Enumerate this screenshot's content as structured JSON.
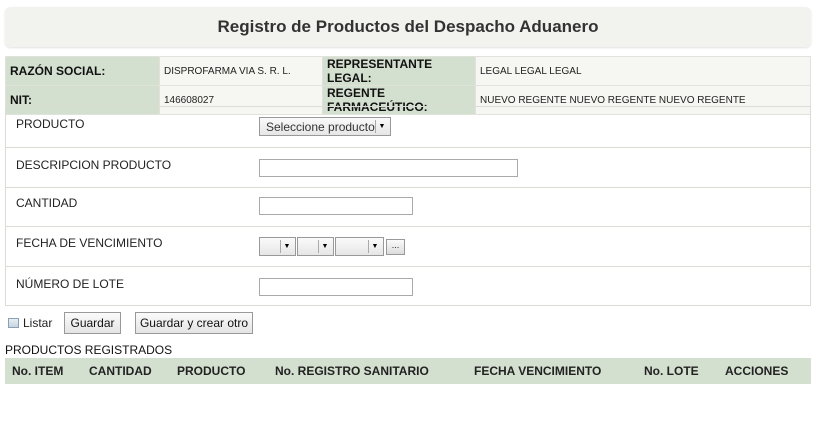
{
  "page": {
    "title": "Registro de Productos del Despacho Aduanero"
  },
  "info": {
    "razon_social_label": "RAZÓN SOCIAL:",
    "razon_social_value": "DISPROFARMA VIA S. R. L.",
    "representante_label": "REPRESENTANTE LEGAL:",
    "representante_value": "LEGAL LEGAL LEGAL",
    "nit_label": "NIT:",
    "nit_value": "146608027",
    "regente_label": "REGENTE FARMACEÚTICO:",
    "regente_value": "NUEVO REGENTE NUEVO REGENTE NUEVO REGENTE"
  },
  "form": {
    "producto_label": "PRODUCTO",
    "producto_select": "Seleccione producto",
    "descripcion_label": "DESCRIPCION PRODUCTO",
    "descripcion_value": "",
    "cantidad_label": "CANTIDAD",
    "cantidad_value": "",
    "fecha_label": "FECHA DE VENCIMIENTO",
    "fecha_day": "",
    "fecha_month": "",
    "fecha_year": "",
    "date_picker_label": "...",
    "lote_label": "NÚMERO DE LOTE",
    "lote_value": ""
  },
  "actions": {
    "listar_label": "Listar",
    "guardar_label": "Guardar",
    "guardar_crear_label": "Guardar y crear otro"
  },
  "registered": {
    "title": "PRODUCTOS REGISTRADOS",
    "columns": [
      "No. ITEM",
      "CANTIDAD",
      "PRODUCTO",
      "No. REGISTRO SANITARIO",
      "FECHA VENCIMIENTO",
      "No. LOTE",
      "ACCIONES"
    ]
  }
}
